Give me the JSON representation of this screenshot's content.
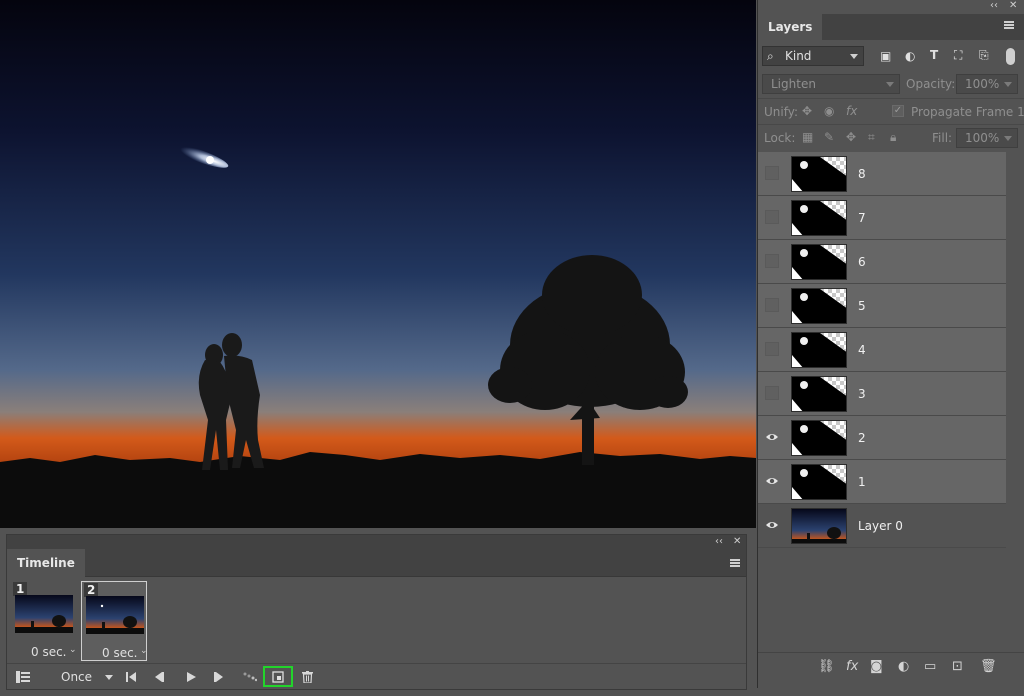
{
  "canvas": {
    "sky_colors": [
      "#04040e",
      "#0d1330",
      "#22375f",
      "#54698a",
      "#d35a1a"
    ]
  },
  "timeline": {
    "panel_collapse": "‹‹",
    "panel_close": "✕",
    "tab_label": "Timeline",
    "frames": [
      {
        "number": "1",
        "delay": "0 sec.",
        "selected": false
      },
      {
        "number": "2",
        "delay": "0 sec.",
        "selected": true
      }
    ],
    "loop_option": "Once",
    "highlight_color": "#22d42b"
  },
  "layers_panel": {
    "panel_collapse": "‹‹",
    "panel_close": "✕",
    "tab_label": "Layers",
    "filter_kind": "Kind",
    "blend_mode": "Lighten",
    "opacity_label": "Opacity:",
    "opacity_value": "100%",
    "unify_label": "Unify:",
    "propagate_label": "Propagate Frame 1",
    "lock_label": "Lock:",
    "fill_label": "Fill:",
    "fill_value": "100%",
    "layers": [
      {
        "name": "8",
        "visible": false
      },
      {
        "name": "7",
        "visible": false
      },
      {
        "name": "6",
        "visible": false
      },
      {
        "name": "5",
        "visible": false
      },
      {
        "name": "4",
        "visible": false
      },
      {
        "name": "3",
        "visible": false
      },
      {
        "name": "2",
        "visible": true
      },
      {
        "name": "1",
        "visible": true
      },
      {
        "name": "Layer 0",
        "visible": true
      }
    ]
  }
}
